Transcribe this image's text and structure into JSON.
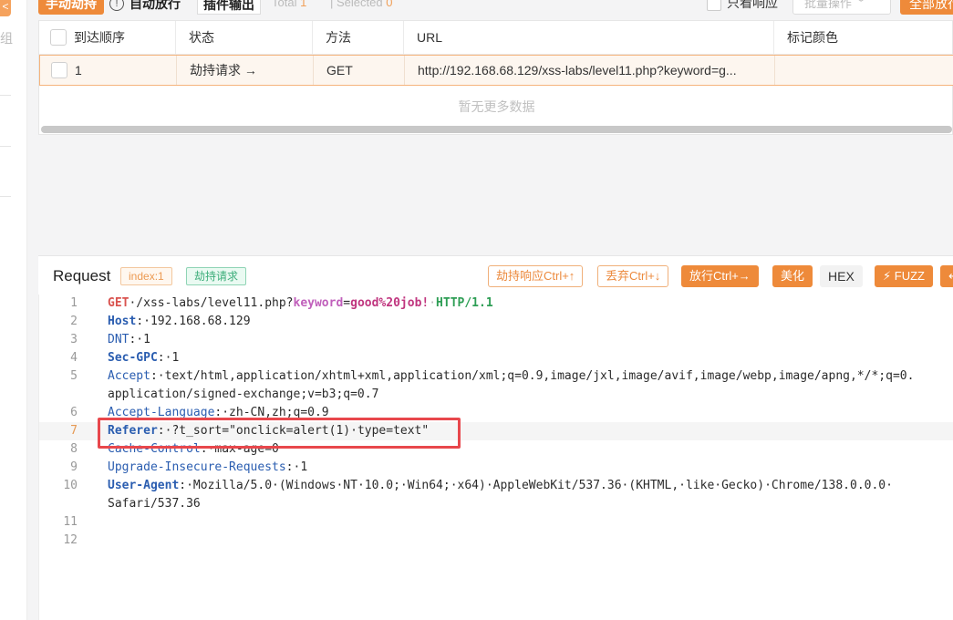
{
  "toolbar": {
    "manual_hijack": "手动劫持",
    "auto_release": "自动放行",
    "plugin_output": "插件输出",
    "total_label": "Total",
    "total_value": "1",
    "selected_label": "Selected",
    "selected_value": "0",
    "only_response": "只看响应",
    "batch_ops": "批量操作",
    "release_all": "全部放行"
  },
  "left_strip": {
    "partial_text": "组"
  },
  "table": {
    "columns": [
      "到达顺序",
      "状态",
      "方法",
      "URL",
      "标记颜色"
    ],
    "rows": [
      {
        "order": "1",
        "status": "劫持请求 →",
        "method": "GET",
        "url": "http://192.168.68.129/xss-labs/level11.php?keyword=g...",
        "mark": ""
      }
    ],
    "empty_text": "暂无更多数据"
  },
  "request": {
    "title": "Request",
    "index_tag": "index:1",
    "hijack_tag": "劫持请求",
    "buttons": {
      "hijack_response": "劫持响应Ctrl+↑",
      "discard": "丢弃Ctrl+↓",
      "release": "放行Ctrl+→",
      "beautify": "美化",
      "hex": "HEX",
      "fuzz": "FUZZ"
    },
    "lines": [
      {
        "n": "1",
        "method": "GET",
        "path": "·/xss-labs/level11.php?",
        "param": "keyword",
        "eq": "=",
        "value": "good%20job!",
        "proto": "HTTP/1.1"
      },
      {
        "n": "2",
        "name": "Host",
        "rest": ":·192.168.68.129"
      },
      {
        "n": "3",
        "name": "DNT",
        "rest": ":·1"
      },
      {
        "n": "4",
        "name": "Sec-GPC",
        "rest": ":·1"
      },
      {
        "n": "5",
        "name": "Accept",
        "rest": ":·text/html,application/xhtml+xml,application/xml;q=0.9,image/jxl,image/avif,image/webp,image/apng,*/*;q=0.",
        "cont": "application/signed-exchange;v=b3;q=0.7"
      },
      {
        "n": "6",
        "name": "Accept-Language",
        "rest": ":·zh-CN,zh;q=0.9"
      },
      {
        "n": "7",
        "name": "Referer",
        "rest": ":·?t_sort=\"onclick=alert(1)·type=text\""
      },
      {
        "n": "8",
        "name": "Cache-Control",
        "rest": ":·max-age=0"
      },
      {
        "n": "9",
        "name": "Upgrade-Insecure-Requests",
        "rest": ":·1"
      },
      {
        "n": "10",
        "name": "User-Agent",
        "rest": ":·Mozilla/5.0·(Windows·NT·10.0;·Win64;·x64)·AppleWebKit/537.36·(KHTML,·like·Gecko)·Chrome/138.0.0.0·",
        "cont": "Safari/537.36"
      },
      {
        "n": "11"
      },
      {
        "n": "12"
      }
    ]
  },
  "colors": {
    "accent_orange": "#ee8a3a",
    "selected_row_bg": "#fdf6ef",
    "highlight_box": "#e8474c",
    "hijack_tag_green": "#3dae7a"
  }
}
